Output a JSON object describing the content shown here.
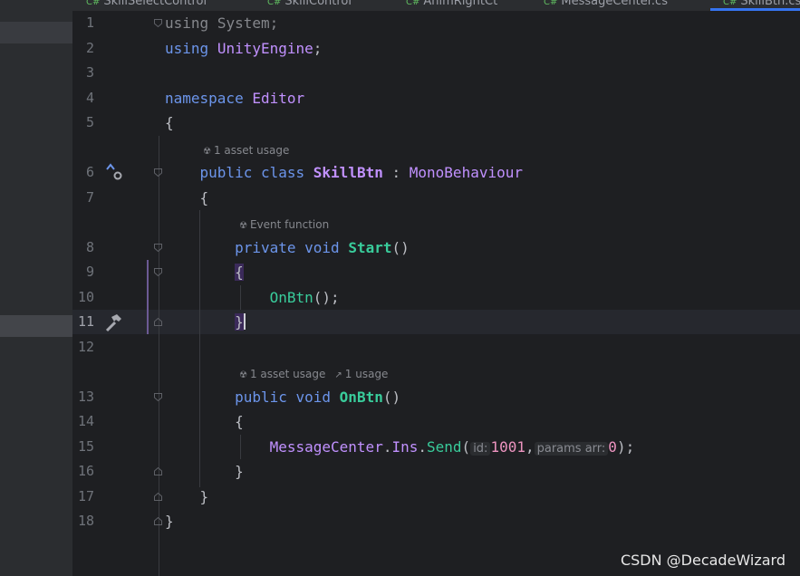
{
  "tabs": [
    {
      "label": "SkillSelectControl"
    },
    {
      "label": "SkillControl"
    },
    {
      "label": "AnimRightCt"
    },
    {
      "label": "MessageCenter.cs"
    },
    {
      "label": "SkillBtn.cs"
    }
  ],
  "editor": {
    "line_numbers": [
      "1",
      "2",
      "3",
      "4",
      "5",
      "6",
      "7",
      "8",
      "9",
      "10",
      "11",
      "12",
      "13",
      "14",
      "15",
      "16",
      "17",
      "18"
    ],
    "tokens": {
      "l1_using": "using",
      "l1_ns": "System",
      "l1_semi": ";",
      "l2_using": "using",
      "l2_ns": "UnityEngine",
      "l2_semi": ";",
      "l4_kw": "namespace",
      "l4_name": "Editor",
      "l5_brace": "{",
      "l6_kw1": "public",
      "l6_kw2": "class",
      "l6_name": "SkillBtn",
      "l6_colon": ":",
      "l6_base": "MonoBehaviour",
      "l7_brace": "{",
      "l8_kw1": "private",
      "l8_kw2": "void",
      "l8_name": "Start",
      "l8_parens": "()",
      "l9_brace": "{",
      "l10_call": "OnBtn",
      "l10_rest": "();",
      "l11_brace": "}",
      "l13_kw1": "public",
      "l13_kw2": "void",
      "l13_name": "OnBtn",
      "l13_parens": "()",
      "l14_brace": "{",
      "l15_cls": "MessageCenter",
      "l15_dot1": ".",
      "l15_ins": "Ins",
      "l15_dot2": ".",
      "l15_send": "Send",
      "l15_open": "(",
      "l15_hint1": "id:",
      "l15_v1": "1001",
      "l15_comma": ",",
      "l15_hint2": "params arr:",
      "l15_v2": "0",
      "l15_close": ");",
      "l16_brace": "}",
      "l17_brace": "}",
      "l18_brace": "}"
    },
    "lenses": {
      "class_usage": "1 asset usage",
      "start_event": "Event function",
      "onbtn_asset_usage": "1 asset usage",
      "onbtn_usage": "1 usage"
    },
    "icons": {
      "lens_asset": "unity-icon",
      "lens_usage": "usage-arrow-icon",
      "gutter_line6": "implements-icon",
      "gutter_line11": "hammer-icon"
    }
  },
  "watermark": "CSDN @DecadeWizard",
  "colors": {
    "keyword": "#6c95eb",
    "type": "#c191ff",
    "method": "#39cc9b",
    "number": "#ed94c0",
    "text": "#bcbec4",
    "background": "#1e1f22"
  }
}
